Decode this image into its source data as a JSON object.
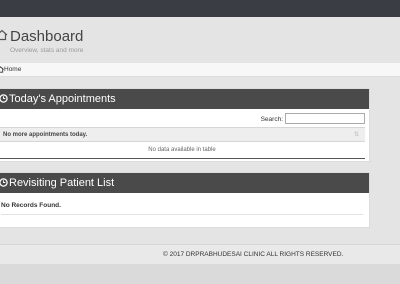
{
  "header": {
    "title": "Dashboard",
    "subtitle": "Overview, stats and more",
    "icon": "home-icon"
  },
  "breadcrumb": {
    "label": "Home",
    "icon": "home-icon"
  },
  "appointments": {
    "title": "Today's Appointments",
    "icon": "clock-icon",
    "search_label": "Search:",
    "search_value": "",
    "column_header": "No more appointments today.",
    "empty_message": "No data available in table"
  },
  "revisiting": {
    "title": "Revisiting Patient List",
    "icon": "clock-icon",
    "message": "No Records Found."
  },
  "footer": {
    "text": "© 2017 DRPRABHUDESAI CLINIC ALL RIGHTS RESERVED."
  },
  "colors": {
    "topbar": "#3b3d45",
    "panel_header": "#4a4a4a",
    "page_bg": "#e4e4e4"
  }
}
